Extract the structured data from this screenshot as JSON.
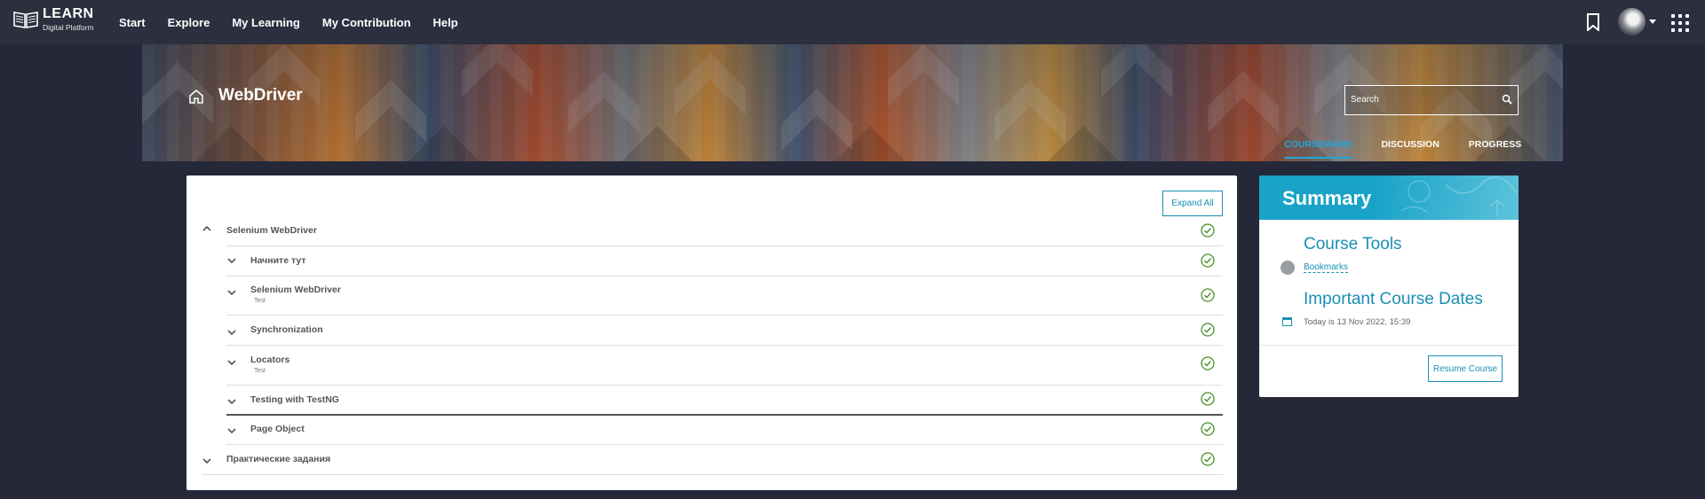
{
  "brand": {
    "title": "LEARN",
    "subtitle": "Digital Platform"
  },
  "nav": {
    "items": [
      "Start",
      "Explore",
      "My Learning",
      "My Contribution",
      "Help"
    ]
  },
  "course": {
    "title": "WebDriver"
  },
  "search": {
    "placeholder": "Search"
  },
  "tabs": [
    {
      "label": "COURSEWARE",
      "active": true
    },
    {
      "label": "DISCUSSION",
      "active": false
    },
    {
      "label": "PROGRESS",
      "active": false
    }
  ],
  "courseware": {
    "expand_all_label": "Expand All",
    "sections": [
      {
        "title": "Selenium WebDriver",
        "expanded": true
      },
      {
        "title": "Практические задания",
        "expanded": false
      }
    ],
    "subsections": [
      {
        "title": "Начните тут",
        "sub": ""
      },
      {
        "title": "Selenium WebDriver",
        "sub": "Test"
      },
      {
        "title": "Synchronization",
        "sub": ""
      },
      {
        "title": "Locators",
        "sub": "Test"
      },
      {
        "title": "Testing with TestNG",
        "sub": ""
      },
      {
        "title": "Page Object",
        "sub": ""
      }
    ]
  },
  "summary": {
    "title": "Summary",
    "course_tools": {
      "heading": "Course Tools",
      "bookmarks_label": "Bookmarks"
    },
    "dates": {
      "heading": "Important Course Dates",
      "today": "Today is 13 Nov 2022, 15:39"
    },
    "resume_label": "Resume Course"
  },
  "colors": {
    "accent": "#1a8fb4",
    "check": "#4a8f2a",
    "nav_bg": "#2b2f3e",
    "page_bg": "#252838"
  },
  "icons": [
    "book-icon",
    "bookmark-icon",
    "avatar",
    "apps-grid-icon",
    "home-icon",
    "search-icon",
    "chevron-up-icon",
    "chevron-down-icon",
    "check-circle-icon",
    "calendar-icon"
  ]
}
